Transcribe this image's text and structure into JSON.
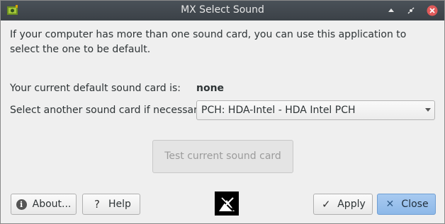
{
  "window": {
    "title": "MX Select Sound"
  },
  "intro_text": "If your computer has more than one sound card, you can use this application to select the one to be default.",
  "current_card": {
    "label": "Your current default sound card is:",
    "value": "none"
  },
  "select_card": {
    "label": "Select another sound card if necessary:",
    "selected": "PCH: HDA-Intel - HDA Intel PCH"
  },
  "test_button": {
    "label": "Test current sound card"
  },
  "buttons": {
    "about": "About...",
    "help": "Help",
    "apply": "Apply",
    "close": "Close"
  },
  "icons": {
    "app": "mx-sound-icon",
    "about": "info-icon",
    "help": "question-icon",
    "apply": "checkmark-icon",
    "close": "x-icon",
    "logo": "mx-linux-logo"
  },
  "colors": {
    "titlebar": "#3b4147",
    "close_button": "#8db8e8",
    "titlebar_close": "#e05a5a"
  }
}
